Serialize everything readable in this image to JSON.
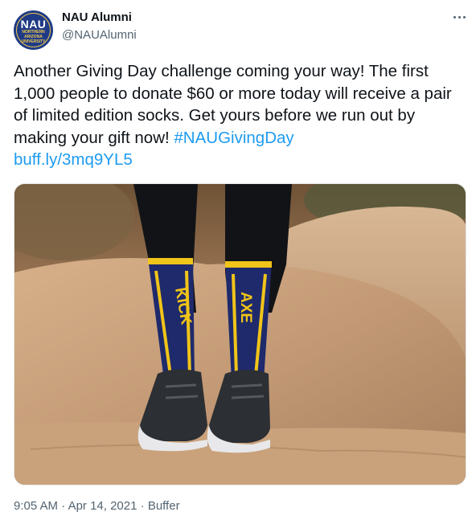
{
  "tweet": {
    "author_name": "NAU Alumni",
    "author_handle": "@NAUAlumni",
    "avatar": {
      "logo_text": "NAU",
      "sub_text": "NORTHERN ARIZONA UNIVERSITY"
    },
    "text": "Another Giving Day challenge coming your way! The first 1,000 people to donate $60 or more today will receive a pair of limited edition socks. Get yours before we run out by making your gift now! ",
    "hashtag": "#NAUGivingDay",
    "link": "buff.ly/3mq9YL5",
    "photo": {
      "sock_left_text": "KICK",
      "sock_right_text": "AXE"
    },
    "time": "9:05 AM",
    "separator": "·",
    "date": "Apr 14, 2021",
    "source": "Buffer"
  },
  "colors": {
    "link": "#1d9bf0",
    "sock_navy": "#1e2a6b",
    "sock_gold": "#f0c419",
    "muted": "#536471"
  },
  "icons": {
    "more": "more-horizontal-icon"
  }
}
